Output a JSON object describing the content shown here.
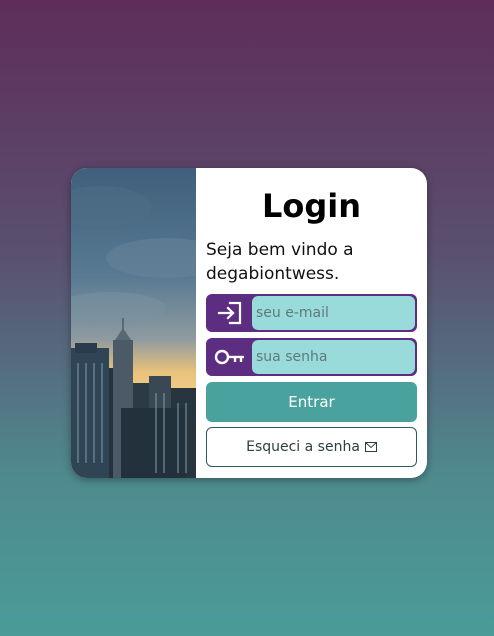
{
  "login": {
    "title": "Login",
    "welcome": "Seja bem vindo a degabiontwess.",
    "email": {
      "value": "",
      "placeholder": "seu e-mail",
      "icon": "login-arrow-icon"
    },
    "password": {
      "value": "",
      "placeholder": "sua senha",
      "icon": "key-icon"
    },
    "submit_label": "Entrar",
    "forgot_label": "Esqueci a senha",
    "forgot_icon": "envelope-icon"
  },
  "colors": {
    "field_bg": "#99dada",
    "field_frame": "#5c2d80",
    "submit_bg": "#4aa29e"
  }
}
